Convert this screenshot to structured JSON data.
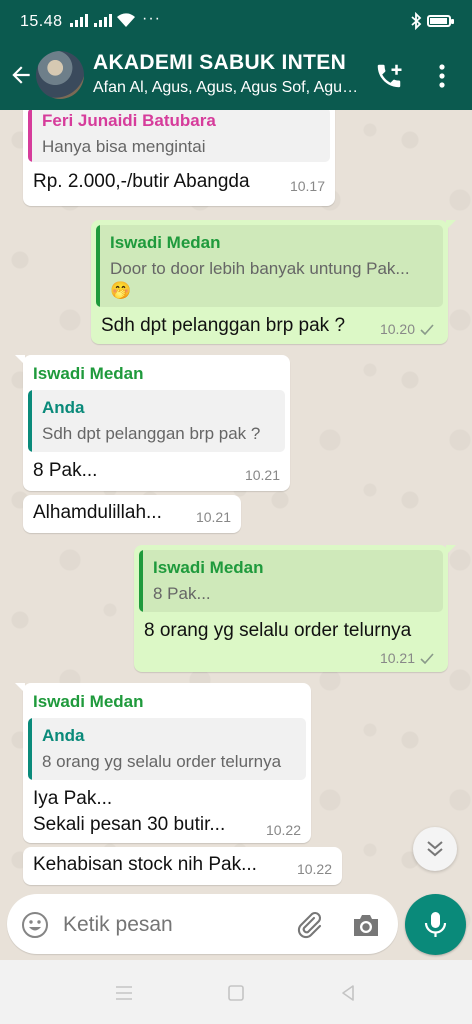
{
  "status_bar": {
    "time": "15.48",
    "dots": "···"
  },
  "header": {
    "title": "AKADEMI SABUK INTEN",
    "subtitle": "Afan Al, Agus, Agus, Agus Sof, Agus, Agus"
  },
  "messages": [
    {
      "dir": "in",
      "quote_name": "Feri Junaidi Batubara",
      "quote_text": "Hanya bisa mengintai",
      "text": "Rp. 2.000,-/butir Abangda",
      "time": "10.17"
    },
    {
      "dir": "out",
      "quote_name": "Iswadi Medan",
      "quote_text": "Door to door lebih banyak untung Pak...",
      "quote_emoji": "🤭",
      "text": "Sdh dpt pelanggan brp pak ?",
      "time": "10.20"
    },
    {
      "dir": "in",
      "sender": "Iswadi Medan",
      "quote_name": "Anda",
      "quote_text": "Sdh dpt pelanggan brp pak ?",
      "text": "8 Pak...",
      "time": "10.21"
    },
    {
      "dir": "in",
      "text": "Alhamdulillah...",
      "time": "10.21"
    },
    {
      "dir": "out",
      "quote_name": "Iswadi Medan",
      "quote_text": "8 Pak...",
      "text": "8 orang yg selalu order telurnya",
      "time": "10.21"
    },
    {
      "dir": "in",
      "sender": "Iswadi Medan",
      "quote_name": "Anda",
      "quote_text": "8 orang yg selalu order telurnya",
      "text_line1": "Iya Pak...",
      "text_line2": "Sekali pesan 30 butir...",
      "time": "10.22"
    },
    {
      "dir": "in",
      "text": "Kehabisan stock nih Pak...",
      "time": "10.22"
    }
  ],
  "input": {
    "placeholder": "Ketik pesan"
  },
  "icons": [
    "back-arrow-icon",
    "add-call-icon",
    "more-vert-icon",
    "emoji-icon",
    "attach-icon",
    "camera-icon",
    "mic-icon",
    "chevron-down-icon"
  ],
  "colors": {
    "header": "#0b5a4f",
    "outgoing": "#dcf8c6",
    "incoming": "#ffffff",
    "accent": "#0a8a7a",
    "green_name": "#1f9a3c",
    "pink_name": "#d63c9b"
  }
}
